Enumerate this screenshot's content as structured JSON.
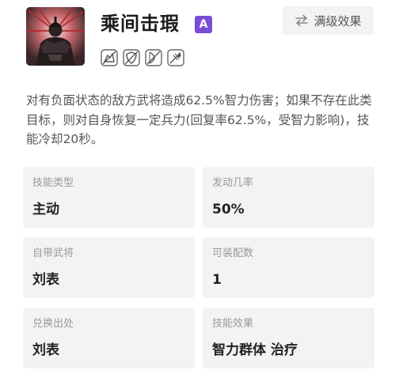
{
  "skill": {
    "name": "乘间击瑕",
    "grade": "A",
    "icon": "skill-portrait-icon"
  },
  "header": {
    "max_effect_label": "满级效果",
    "max_effect_icon": "swap-arrows-icon"
  },
  "troop_types": [
    {
      "icon": "cavalry-icon"
    },
    {
      "icon": "shield-icon"
    },
    {
      "icon": "archer-icon"
    },
    {
      "icon": "spear-icon"
    }
  ],
  "description": "对有负面状态的敌方武将造成62.5%智力伤害；如果不存在此类目标，则对自身恢复一定兵力(回复率62.5%，受智力影响)，技能冷却20秒。",
  "info": {
    "skill_type": {
      "label": "技能类型",
      "value": "主动"
    },
    "trigger_rate": {
      "label": "发动几率",
      "value": "50%"
    },
    "general": {
      "label": "自带武将",
      "value": "刘表"
    },
    "equip_count": {
      "label": "可装配数",
      "value": "1"
    },
    "source": {
      "label": "兑换出处",
      "value": "刘表"
    },
    "effect": {
      "label": "技能效果",
      "value": "智力群体 治疗"
    }
  },
  "colors": {
    "grade_badge": "#7b4cd8",
    "card_bg": "#f2f3f5",
    "icon_bg": "#2a2122",
    "icon_accent": "#c8353a"
  }
}
